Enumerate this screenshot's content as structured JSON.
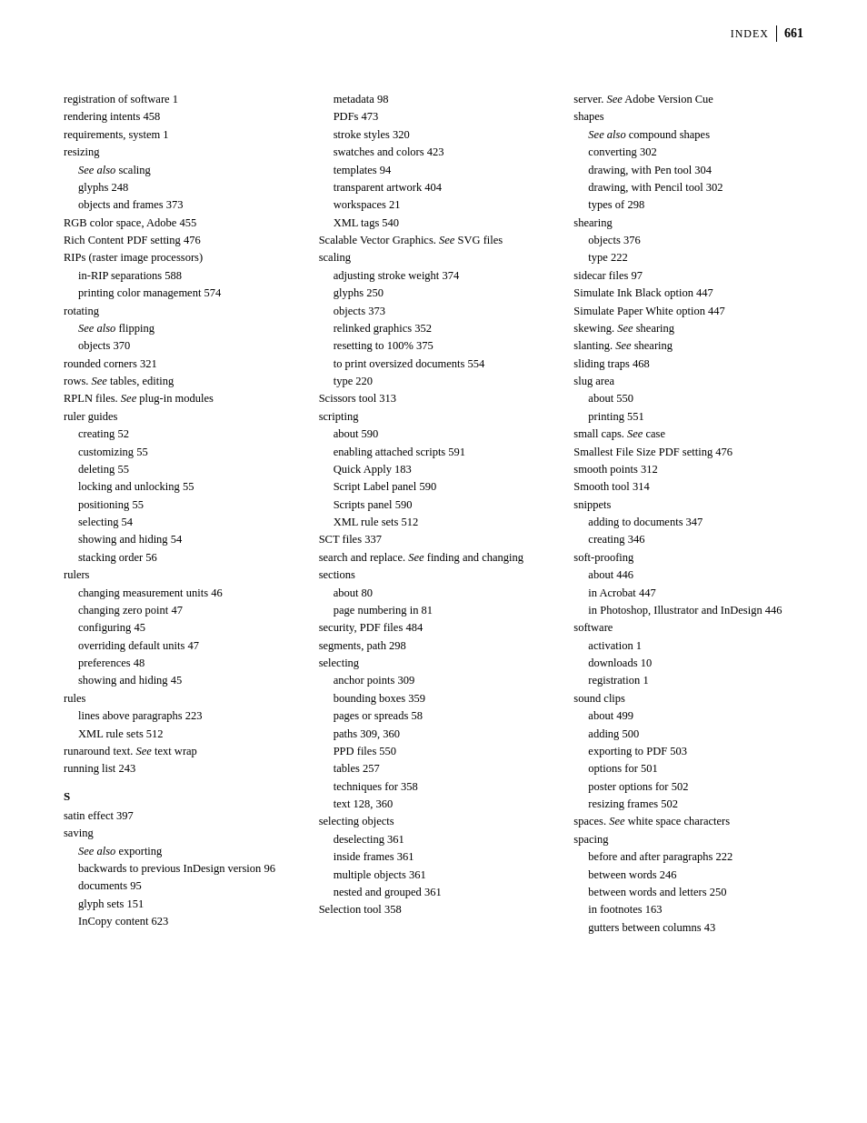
{
  "header": {
    "label": "INDEX",
    "page": "661"
  },
  "columns": [
    {
      "id": "col1",
      "entries": [
        {
          "level": 0,
          "text": "registration of software 1"
        },
        {
          "level": 0,
          "text": "rendering intents 458"
        },
        {
          "level": 0,
          "text": "requirements, system 1"
        },
        {
          "level": 0,
          "text": "resizing"
        },
        {
          "level": 1,
          "text": "<em>See also</em> scaling",
          "italic": true
        },
        {
          "level": 1,
          "text": "glyphs 248"
        },
        {
          "level": 1,
          "text": "objects and frames 373"
        },
        {
          "level": 0,
          "text": "RGB color space, Adobe 455"
        },
        {
          "level": 0,
          "text": "Rich Content PDF setting 476"
        },
        {
          "level": 0,
          "text": "RIPs (raster image processors)"
        },
        {
          "level": 1,
          "text": "in-RIP separations 588"
        },
        {
          "level": 1,
          "text": "printing color management 574"
        },
        {
          "level": 0,
          "text": "rotating"
        },
        {
          "level": 1,
          "text": "<em>See also</em> flipping",
          "italic": true
        },
        {
          "level": 1,
          "text": "objects 370"
        },
        {
          "level": 0,
          "text": "rounded corners 321"
        },
        {
          "level": 0,
          "text": "rows. <em>See</em> tables, editing"
        },
        {
          "level": 0,
          "text": "RPLN files. <em>See</em> plug-in modules"
        },
        {
          "level": 0,
          "text": "ruler guides"
        },
        {
          "level": 1,
          "text": "creating 52"
        },
        {
          "level": 1,
          "text": "customizing 55"
        },
        {
          "level": 1,
          "text": "deleting 55"
        },
        {
          "level": 1,
          "text": "locking and unlocking 55"
        },
        {
          "level": 1,
          "text": "positioning 55"
        },
        {
          "level": 1,
          "text": "selecting 54"
        },
        {
          "level": 1,
          "text": "showing and hiding 54"
        },
        {
          "level": 1,
          "text": "stacking order 56"
        },
        {
          "level": 0,
          "text": "rulers"
        },
        {
          "level": 1,
          "text": "changing measurement units 46"
        },
        {
          "level": 1,
          "text": "changing zero point 47"
        },
        {
          "level": 1,
          "text": "configuring 45"
        },
        {
          "level": 1,
          "text": "overriding default units 47"
        },
        {
          "level": 1,
          "text": "preferences 48"
        },
        {
          "level": 1,
          "text": "showing and hiding 45"
        },
        {
          "level": 0,
          "text": "rules"
        },
        {
          "level": 1,
          "text": "lines above paragraphs 223"
        },
        {
          "level": 1,
          "text": "XML rule sets 512"
        },
        {
          "level": 0,
          "text": "runaround text. <em>See</em> text wrap"
        },
        {
          "level": 0,
          "text": "running list 243"
        },
        {
          "level": "letter",
          "text": "S"
        },
        {
          "level": 0,
          "text": "satin effect 397"
        },
        {
          "level": 0,
          "text": "saving"
        },
        {
          "level": 1,
          "text": "<em>See also</em> exporting",
          "italic": true
        },
        {
          "level": 1,
          "text": "backwards to previous InDesign version 96"
        },
        {
          "level": 1,
          "text": "documents 95"
        },
        {
          "level": 1,
          "text": "glyph sets 151"
        },
        {
          "level": 1,
          "text": "InCopy content 623"
        }
      ]
    },
    {
      "id": "col2",
      "entries": [
        {
          "level": 1,
          "text": "metadata 98"
        },
        {
          "level": 1,
          "text": "PDFs 473"
        },
        {
          "level": 1,
          "text": "stroke styles 320"
        },
        {
          "level": 1,
          "text": "swatches and colors 423"
        },
        {
          "level": 1,
          "text": "templates 94"
        },
        {
          "level": 1,
          "text": "transparent artwork 404"
        },
        {
          "level": 1,
          "text": "workspaces 21"
        },
        {
          "level": 1,
          "text": "XML tags 540"
        },
        {
          "level": 0,
          "text": "Scalable Vector Graphics. <em>See</em> SVG files"
        },
        {
          "level": 0,
          "text": "scaling"
        },
        {
          "level": 1,
          "text": "adjusting stroke weight 374"
        },
        {
          "level": 1,
          "text": "glyphs 250"
        },
        {
          "level": 1,
          "text": "objects 373"
        },
        {
          "level": 1,
          "text": "relinked graphics 352"
        },
        {
          "level": 1,
          "text": "resetting to 100% 375"
        },
        {
          "level": 1,
          "text": "to print oversized documents 554"
        },
        {
          "level": 1,
          "text": "type 220"
        },
        {
          "level": 0,
          "text": "Scissors tool 313"
        },
        {
          "level": 0,
          "text": "scripting"
        },
        {
          "level": 1,
          "text": "about 590"
        },
        {
          "level": 1,
          "text": "enabling attached scripts 591"
        },
        {
          "level": 1,
          "text": "Quick Apply 183"
        },
        {
          "level": 1,
          "text": "Script Label panel 590"
        },
        {
          "level": 1,
          "text": "Scripts panel 590"
        },
        {
          "level": 1,
          "text": "XML rule sets 512"
        },
        {
          "level": 0,
          "text": "SCT files 337"
        },
        {
          "level": 0,
          "text": "search and replace. <em>See</em> finding and changing"
        },
        {
          "level": 0,
          "text": "sections"
        },
        {
          "level": 1,
          "text": "about 80"
        },
        {
          "level": 1,
          "text": "page numbering in 81"
        },
        {
          "level": 0,
          "text": "security, PDF files 484"
        },
        {
          "level": 0,
          "text": "segments, path 298"
        },
        {
          "level": 0,
          "text": "selecting"
        },
        {
          "level": 1,
          "text": "anchor points 309"
        },
        {
          "level": 1,
          "text": "bounding boxes 359"
        },
        {
          "level": 1,
          "text": "pages or spreads 58"
        },
        {
          "level": 1,
          "text": "paths 309, 360"
        },
        {
          "level": 1,
          "text": "PPD files 550"
        },
        {
          "level": 1,
          "text": "tables 257"
        },
        {
          "level": 1,
          "text": "techniques for 358"
        },
        {
          "level": 1,
          "text": "text 128, 360"
        },
        {
          "level": 0,
          "text": "selecting objects"
        },
        {
          "level": 1,
          "text": "deselecting 361"
        },
        {
          "level": 1,
          "text": "inside frames 361"
        },
        {
          "level": 1,
          "text": "multiple objects 361"
        },
        {
          "level": 1,
          "text": "nested and grouped 361"
        },
        {
          "level": 0,
          "text": "Selection tool 358"
        }
      ]
    },
    {
      "id": "col3",
      "entries": [
        {
          "level": 0,
          "text": "server. <em>See</em> Adobe Version Cue"
        },
        {
          "level": 0,
          "text": "shapes"
        },
        {
          "level": 1,
          "text": "<em>See also</em> compound shapes",
          "italic": true
        },
        {
          "level": 1,
          "text": "converting 302"
        },
        {
          "level": 1,
          "text": "drawing, with Pen tool 304"
        },
        {
          "level": 1,
          "text": "drawing, with Pencil tool 302"
        },
        {
          "level": 1,
          "text": "types of 298"
        },
        {
          "level": 0,
          "text": "shearing"
        },
        {
          "level": 1,
          "text": "objects 376"
        },
        {
          "level": 1,
          "text": "type 222"
        },
        {
          "level": 0,
          "text": "sidecar files 97"
        },
        {
          "level": 0,
          "text": "Simulate Ink Black option 447"
        },
        {
          "level": 0,
          "text": "Simulate Paper White option 447"
        },
        {
          "level": 0,
          "text": "skewing. <em>See</em> shearing"
        },
        {
          "level": 0,
          "text": "slanting. <em>See</em> shearing"
        },
        {
          "level": 0,
          "text": "sliding traps 468"
        },
        {
          "level": 0,
          "text": "slug area"
        },
        {
          "level": 1,
          "text": "about 550"
        },
        {
          "level": 1,
          "text": "printing 551"
        },
        {
          "level": 0,
          "text": "small caps. <em>See</em> case"
        },
        {
          "level": 0,
          "text": "Smallest File Size PDF setting 476"
        },
        {
          "level": 0,
          "text": "smooth points 312"
        },
        {
          "level": 0,
          "text": "Smooth tool 314"
        },
        {
          "level": 0,
          "text": "snippets"
        },
        {
          "level": 1,
          "text": "adding to documents 347"
        },
        {
          "level": 1,
          "text": "creating 346"
        },
        {
          "level": 0,
          "text": "soft-proofing"
        },
        {
          "level": 1,
          "text": "about 446"
        },
        {
          "level": 1,
          "text": "in Acrobat 447"
        },
        {
          "level": 1,
          "text": "in Photoshop, Illustrator and InDesign 446"
        },
        {
          "level": 0,
          "text": "software"
        },
        {
          "level": 1,
          "text": "activation 1"
        },
        {
          "level": 1,
          "text": "downloads 10"
        },
        {
          "level": 1,
          "text": "registration 1"
        },
        {
          "level": 0,
          "text": "sound clips"
        },
        {
          "level": 1,
          "text": "about 499"
        },
        {
          "level": 1,
          "text": "adding 500"
        },
        {
          "level": 1,
          "text": "exporting to PDF 503"
        },
        {
          "level": 1,
          "text": "options for 501"
        },
        {
          "level": 1,
          "text": "poster options for 502"
        },
        {
          "level": 1,
          "text": "resizing frames 502"
        },
        {
          "level": 0,
          "text": "spaces. <em>See</em> white space characters"
        },
        {
          "level": 0,
          "text": "spacing"
        },
        {
          "level": 1,
          "text": "before and after paragraphs 222"
        },
        {
          "level": 1,
          "text": "between words 246"
        },
        {
          "level": 1,
          "text": "between words and letters 250"
        },
        {
          "level": 1,
          "text": "in footnotes 163"
        },
        {
          "level": 1,
          "text": "gutters between columns 43"
        }
      ]
    }
  ]
}
